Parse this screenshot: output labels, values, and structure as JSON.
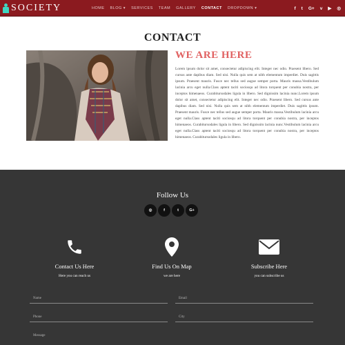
{
  "navbar": {
    "brand": "SOCIETY",
    "menu": [
      {
        "label": "HOME",
        "active": false
      },
      {
        "label": "BLOG ▾",
        "active": false
      },
      {
        "label": "SERVICES",
        "active": false
      },
      {
        "label": "TEAM",
        "active": false
      },
      {
        "label": "GALLERY",
        "active": false
      },
      {
        "label": "CONTACT",
        "active": true
      },
      {
        "label": "DROPDOWN ▾",
        "active": false
      }
    ],
    "social": [
      {
        "name": "facebook-icon",
        "glyph": "f"
      },
      {
        "name": "twitter-icon",
        "glyph": "t"
      },
      {
        "name": "google-plus-icon",
        "glyph": "G+"
      },
      {
        "name": "vimeo-icon",
        "glyph": "v"
      },
      {
        "name": "youtube-icon",
        "glyph": "▶"
      },
      {
        "name": "instagram-icon",
        "glyph": "◎"
      }
    ]
  },
  "contact": {
    "title": "CONTACT",
    "heading": "WE ARE HERE",
    "body": "Lorem ipsum dolor sit amet, consectetur adipiscing elit. Integer nec odio. Praesent libero. Sed cursus ante dapibus diam. Sed nisi. Nulla quis sem at nibh elementum imperdiet. Duis sagittis ipsum. Praesent mauris. Fusce nec tellus sed augue semper porta. Mauris massa.Vestibulum lacinia arcu eget nulla.Class aptent taciti sociosqu ad litora torquent per conubia nostra, per inceptos himenaeos. Curabitursodales ligula in libero. Sed dignissim lacinia nunc.Lorem ipsum dolor sit amet, consectetur adipiscing elit. Integer nec odio. Praesent libero. Sed cursus ante dapibus diam. Sed nisi. Nulla quis sem at nibh elementum imperdiet. Duis sagittis ipsum. Praesent mauris. Fusce nec tellus sed augue semper porta. Mauris massa.Vestibulum lacinia arcu eget nulla.Class aptent taciti sociosqu ad litora torquent per conubia nostra, per inceptos himenaeos. Curabitursodales ligula in libero. Sed dignissim lacinia nunc.Vestibulum lacinia arcu eget nulla.Class aptent taciti sociosqu ad litora torquent per conubia nostra, per inceptos himenaeos. Curabitursodales ligula in libero."
  },
  "footer": {
    "follow_title": "Follow Us",
    "follow_icons": [
      {
        "name": "instagram-icon",
        "glyph": "◎"
      },
      {
        "name": "facebook-icon",
        "glyph": "f"
      },
      {
        "name": "twitter-icon",
        "glyph": "t"
      },
      {
        "name": "google-plus-icon",
        "glyph": "G+"
      }
    ],
    "info": [
      {
        "title": "Contact Us Here",
        "sub": "Here you can reach us",
        "icon": "phone-icon"
      },
      {
        "title": "Find Us On Map",
        "sub": "we are here",
        "icon": "map-pin-icon"
      },
      {
        "title": "Subscribe Here",
        "sub": "you can subscribe us",
        "icon": "envelope-icon"
      }
    ],
    "form": {
      "name_placeholder": "Name",
      "email_placeholder": "Email",
      "phone_placeholder": "Phone",
      "city_placeholder": "City",
      "message_placeholder": "Message"
    }
  },
  "colors": {
    "navbar": "#8b1a1f",
    "brand_icon": "#3fd6c1",
    "heading_accent": "#e06060",
    "footer": "#363636"
  }
}
